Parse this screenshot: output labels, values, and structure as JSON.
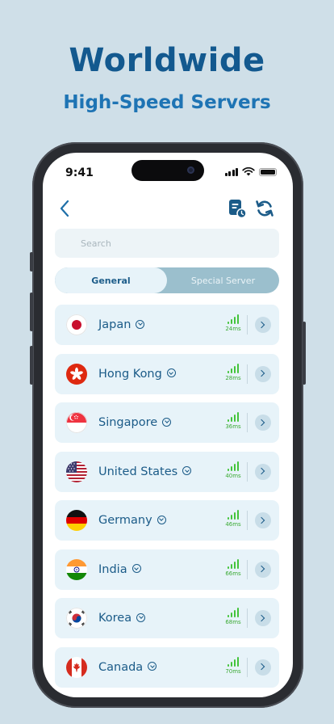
{
  "promo": {
    "headline": "Worldwide",
    "subheadline": "High-Speed Servers"
  },
  "status_bar": {
    "time": "9:41"
  },
  "header": {
    "back_icon": "chevron-left-icon",
    "report_icon": "report-clock-icon",
    "refresh_icon": "refresh-icon"
  },
  "search": {
    "placeholder": "Search",
    "value": ""
  },
  "tabs": [
    {
      "label": "General",
      "active": true
    },
    {
      "label": "Special Server",
      "active": false
    }
  ],
  "colors": {
    "brand": "#13598f",
    "accent": "#1e74b4",
    "signal": "#43c43b",
    "row_bg": "#e7f3f9"
  },
  "servers": [
    {
      "country": "Japan",
      "latency": "24ms",
      "flag": "japan-flag-icon"
    },
    {
      "country": "Hong Kong",
      "latency": "28ms",
      "flag": "hong-kong-flag-icon"
    },
    {
      "country": "Singapore",
      "latency": "36ms",
      "flag": "singapore-flag-icon"
    },
    {
      "country": "United States",
      "latency": "40ms",
      "flag": "united-states-flag-icon"
    },
    {
      "country": "Germany",
      "latency": "46ms",
      "flag": "germany-flag-icon"
    },
    {
      "country": "India",
      "latency": "66ms",
      "flag": "india-flag-icon"
    },
    {
      "country": "Korea",
      "latency": "68ms",
      "flag": "korea-flag-icon"
    },
    {
      "country": "Canada",
      "latency": "70ms",
      "flag": "canada-flag-icon"
    }
  ]
}
